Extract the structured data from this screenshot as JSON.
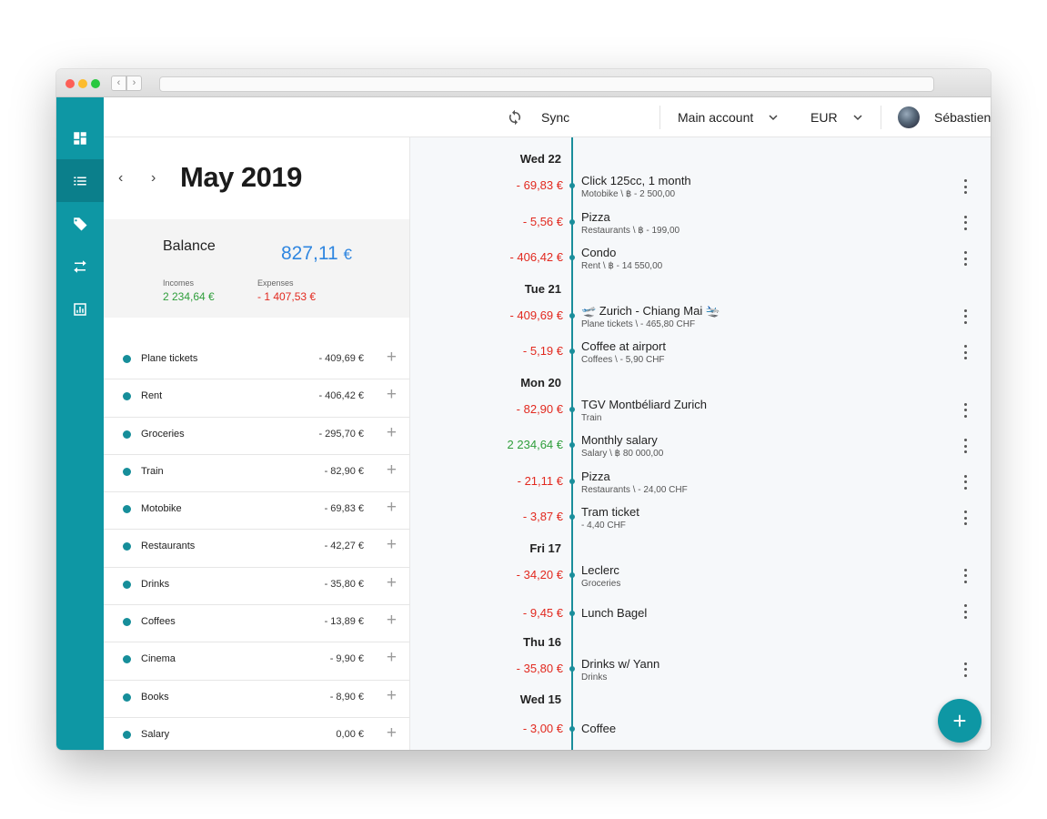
{
  "topbar": {
    "sync_label": "Sync",
    "account": "Main account",
    "currency": "EUR",
    "user_name": "Sébastien"
  },
  "period": {
    "title": "May 2019"
  },
  "balance": {
    "label": "Balance",
    "value": "827,11",
    "currency_symbol": "€",
    "incomes_label": "Incomes",
    "incomes_value": "2 234,64 €",
    "expenses_label": "Expenses",
    "expenses_value": "- 1 407,53 €"
  },
  "categories": [
    {
      "name": "Plane tickets",
      "amount": "- 409,69 €"
    },
    {
      "name": "Rent",
      "amount": "- 406,42 €"
    },
    {
      "name": "Groceries",
      "amount": "- 295,70 €"
    },
    {
      "name": "Train",
      "amount": "- 82,90 €"
    },
    {
      "name": "Motobike",
      "amount": "- 69,83 €"
    },
    {
      "name": "Restaurants",
      "amount": "- 42,27 €"
    },
    {
      "name": "Drinks",
      "amount": "- 35,80 €"
    },
    {
      "name": "Coffees",
      "amount": "- 13,89 €"
    },
    {
      "name": "Cinema",
      "amount": "- 9,90 €"
    },
    {
      "name": "Books",
      "amount": "- 8,90 €"
    },
    {
      "name": "Salary",
      "amount": "0,00 €"
    }
  ],
  "timeline": [
    {
      "type": "day",
      "label": "Wed 22"
    },
    {
      "type": "tx",
      "amount": "- 69,83 €",
      "kind": "expense",
      "title": "Click 125cc, 1 month",
      "subtitle": "Motobike \\ ฿ - 2 500,00"
    },
    {
      "type": "tx",
      "amount": "- 5,56 €",
      "kind": "expense",
      "title": "Pizza",
      "subtitle": "Restaurants \\ ฿ - 199,00"
    },
    {
      "type": "tx",
      "amount": "- 406,42 €",
      "kind": "expense",
      "title": "Condo",
      "subtitle": "Rent \\ ฿ - 14 550,00"
    },
    {
      "type": "day",
      "label": "Tue 21"
    },
    {
      "type": "tx",
      "amount": "- 409,69 €",
      "kind": "expense",
      "title": "🛫 Zurich - Chiang Mai 🛬",
      "subtitle": "Plane tickets \\ - 465,80 CHF"
    },
    {
      "type": "tx",
      "amount": "- 5,19 €",
      "kind": "expense",
      "title": "Coffee at airport",
      "subtitle": "Coffees \\ - 5,90 CHF"
    },
    {
      "type": "day",
      "label": "Mon 20"
    },
    {
      "type": "tx",
      "amount": "- 82,90 €",
      "kind": "expense",
      "title": "TGV Montbéliard Zurich",
      "subtitle": "Train"
    },
    {
      "type": "tx",
      "amount": "2 234,64 €",
      "kind": "income",
      "title": "Monthly salary",
      "subtitle": "Salary \\ ฿ 80 000,00"
    },
    {
      "type": "tx",
      "amount": "- 21,11 €",
      "kind": "expense",
      "title": "Pizza",
      "subtitle": "Restaurants \\ - 24,00 CHF"
    },
    {
      "type": "tx",
      "amount": "- 3,87 €",
      "kind": "expense",
      "title": "Tram ticket",
      "subtitle": "- 4,40 CHF"
    },
    {
      "type": "day",
      "label": "Fri 17"
    },
    {
      "type": "tx",
      "amount": "- 34,20 €",
      "kind": "expense",
      "title": "Leclerc",
      "subtitle": "Groceries"
    },
    {
      "type": "tx",
      "amount": "- 9,45 €",
      "kind": "expense",
      "title": "Lunch Bagel",
      "subtitle": ""
    },
    {
      "type": "day",
      "label": "Thu 16"
    },
    {
      "type": "tx",
      "amount": "- 35,80 €",
      "kind": "expense",
      "title": "Drinks w/ Yann",
      "subtitle": "Drinks"
    },
    {
      "type": "day",
      "label": "Wed 15"
    },
    {
      "type": "tx",
      "amount": "- 3,00 €",
      "kind": "expense",
      "title": "Coffee",
      "subtitle": ""
    }
  ],
  "colors": {
    "accent": "#0e97a4",
    "income": "#2f9e3b",
    "expense": "#e2291f",
    "balance": "#2f86e0"
  },
  "icons": {
    "sidebar": [
      "dashboard-icon",
      "list-icon",
      "tag-icon",
      "transfer-icon",
      "chart-icon"
    ],
    "fab": "plus-icon"
  }
}
